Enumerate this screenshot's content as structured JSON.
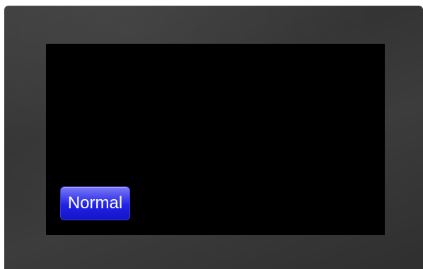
{
  "screen": {
    "background_color": "#000000",
    "bezel_color": "#383838",
    "button": {
      "label": "Normal",
      "color": "#2020e0",
      "text_color": "#ffffff"
    }
  }
}
